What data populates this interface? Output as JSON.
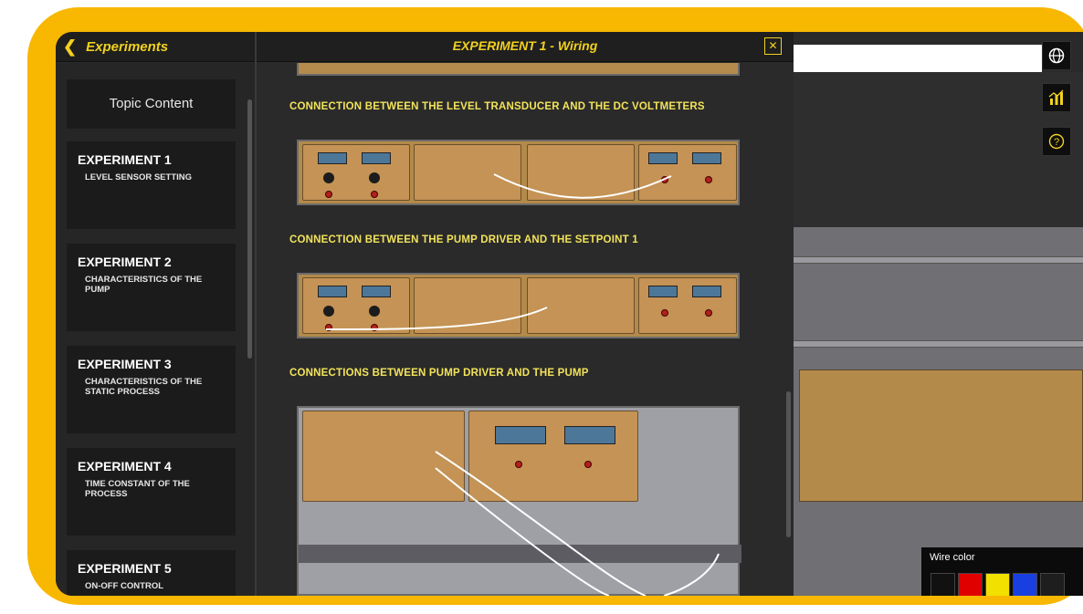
{
  "header": {
    "back_label": "Experiments",
    "title": "EXPERIMENT 1 - Wiring",
    "close_symbol": "✕"
  },
  "sidebar": {
    "topic_label": "Topic Content",
    "items": [
      {
        "heading": "EXPERIMENT 1",
        "sub": "LEVEL SENSOR SETTING"
      },
      {
        "heading": "EXPERIMENT 2",
        "sub": "CHARACTERISTICS OF THE PUMP"
      },
      {
        "heading": "EXPERIMENT 3",
        "sub": "CHARACTERISTICS OF THE STATIC PROCESS"
      },
      {
        "heading": "EXPERIMENT 4",
        "sub": "TIME CONSTANT OF THE PROCESS"
      },
      {
        "heading": "EXPERIMENT 5",
        "sub": "ON-OFF CONTROL"
      }
    ]
  },
  "content": {
    "sections": [
      {
        "title": "CONNECTION BETWEEN THE LEVEL TRANSDUCER AND THE DC VOLTMETERS"
      },
      {
        "title": "CONNECTION BETWEEN THE PUMP DRIVER AND THE SETPOINT 1"
      },
      {
        "title": "CONNECTIONS BETWEEN PUMP DRIVER AND THE PUMP"
      }
    ]
  },
  "scene": {
    "icons": [
      "globe-icon",
      "chart-icon",
      "help-icon"
    ],
    "wire_color_label": "Wire color",
    "wire_colors": [
      "#111111",
      "#e00000",
      "#f2e000",
      "#1a3fe0",
      "#1e1e1e"
    ]
  }
}
